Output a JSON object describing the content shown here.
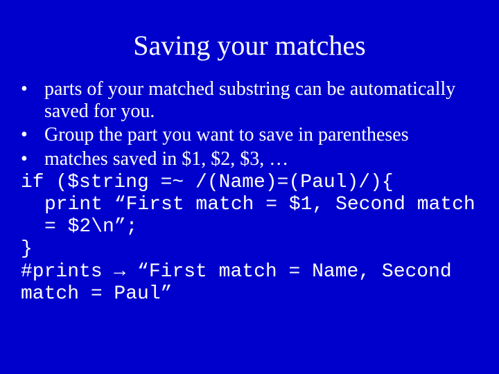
{
  "title": "Saving your matches",
  "bullets": [
    "parts of your matched substring can be automatically saved for you.",
    "Group the part you want to save in parentheses",
    "matches saved in $1, $2, $3, …"
  ],
  "code": {
    "l1": "if ($string =~ /(Name)=(Paul)/){",
    "l2": "print “First match = $1, Second match = $2\\n”;",
    "l3": "}",
    "l4a": "#prints ",
    "arrow": "→",
    "l4b": " “First match = Name, Second match = Paul”"
  }
}
